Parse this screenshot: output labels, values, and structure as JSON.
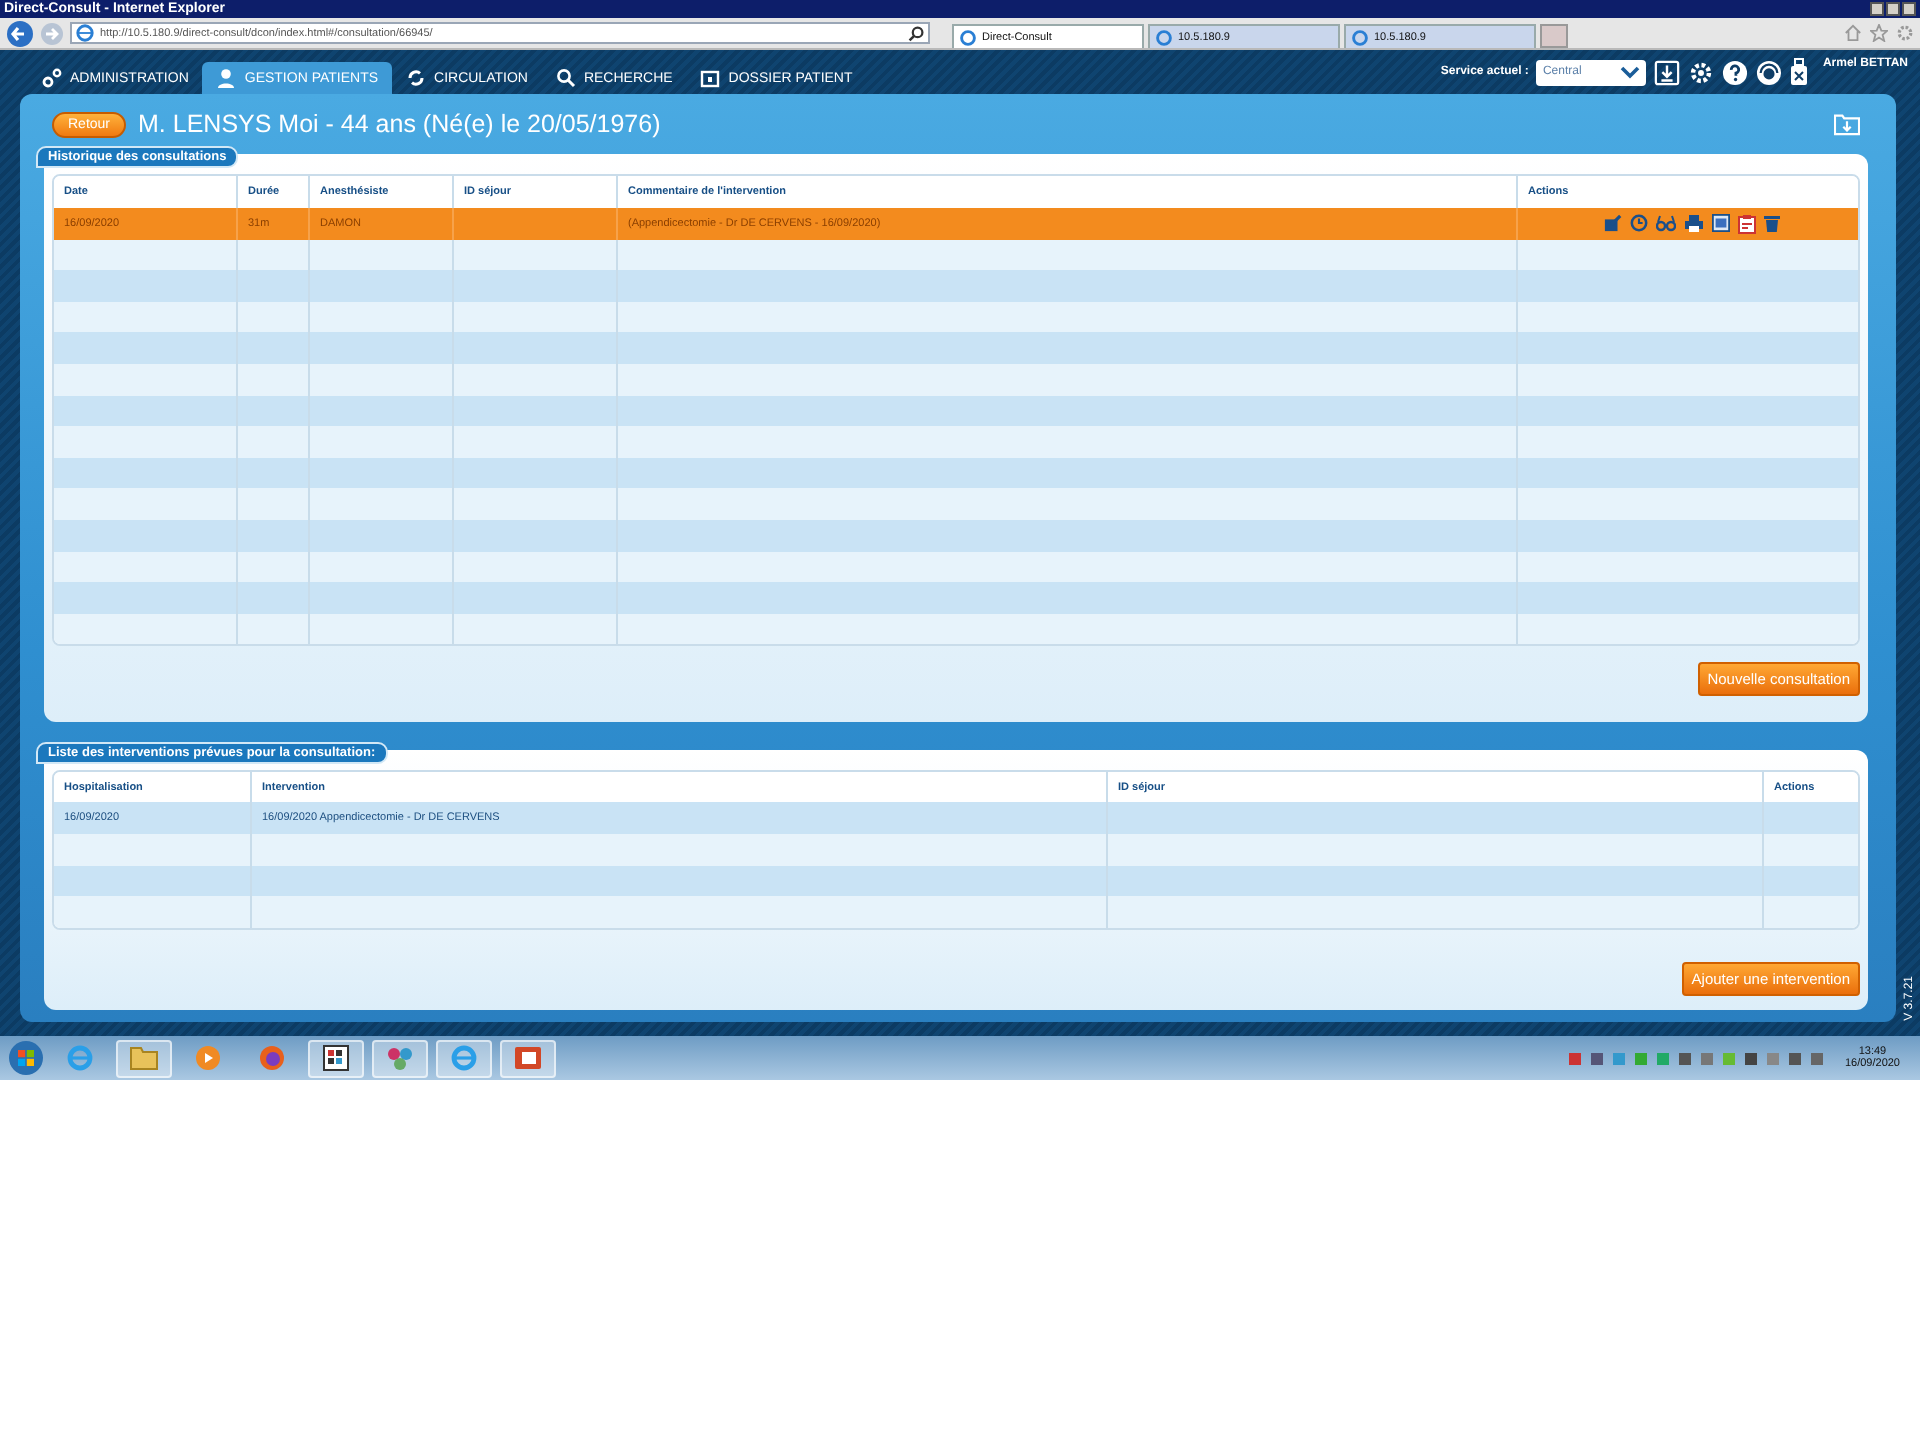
{
  "browser": {
    "title": "Direct-Consult - Internet Explorer",
    "url": "http://10.5.180.9/direct-consult/dcon/index.html#/consultation/66945/",
    "tabs": [
      {
        "label": "Direct-Consult",
        "selected": true
      },
      {
        "label": "10.5.180.9",
        "selected": false
      },
      {
        "label": "10.5.180.9",
        "selected": false
      }
    ]
  },
  "nav": {
    "tabs": [
      {
        "label": "ADMINISTRATION",
        "selected": false,
        "kind": "admin"
      },
      {
        "label": "GESTION PATIENTS",
        "selected": true,
        "kind": "patients"
      },
      {
        "label": "CIRCULATION",
        "selected": false,
        "kind": "circulation"
      },
      {
        "label": "RECHERCHE",
        "selected": false,
        "kind": "search"
      },
      {
        "label": "DOSSIER PATIENT",
        "selected": false,
        "kind": "folder"
      }
    ],
    "service_label": "Service actuel :",
    "service_value": "Central",
    "user": "Armel BETTAN"
  },
  "header": {
    "back": "Retour",
    "title": "M. LENSYS Moi - 44 ans (Né(e) le 20/05/1976)"
  },
  "consultations": {
    "title": "Historique des consultations",
    "columns": [
      "Date",
      "Durée",
      "Anesthésiste",
      "ID séjour",
      "Commentaire de l'intervention",
      "Actions"
    ],
    "rows": [
      {
        "date": "16/09/2020",
        "duree": "31m",
        "anesthesiste": "DAMON",
        "commentaire": "(Appendicectomie - Dr DE CERVENS - 16/09/2020)",
        "selected": true
      }
    ],
    "button": "Nouvelle consultation"
  },
  "interventions": {
    "title": "Liste des interventions prévues pour la consultation:",
    "columns": [
      "Hospitalisation",
      "Intervention",
      "ID séjour",
      "Actions"
    ],
    "rows": [
      {
        "hospitalisation": "16/09/2020",
        "intervention": "16/09/2020 Appendicectomie - Dr DE CERVENS"
      }
    ],
    "button": "Ajouter une intervention"
  },
  "version": "V 3.7.21",
  "taskbar": {
    "time": "13:49",
    "date": "16/09/2020"
  }
}
